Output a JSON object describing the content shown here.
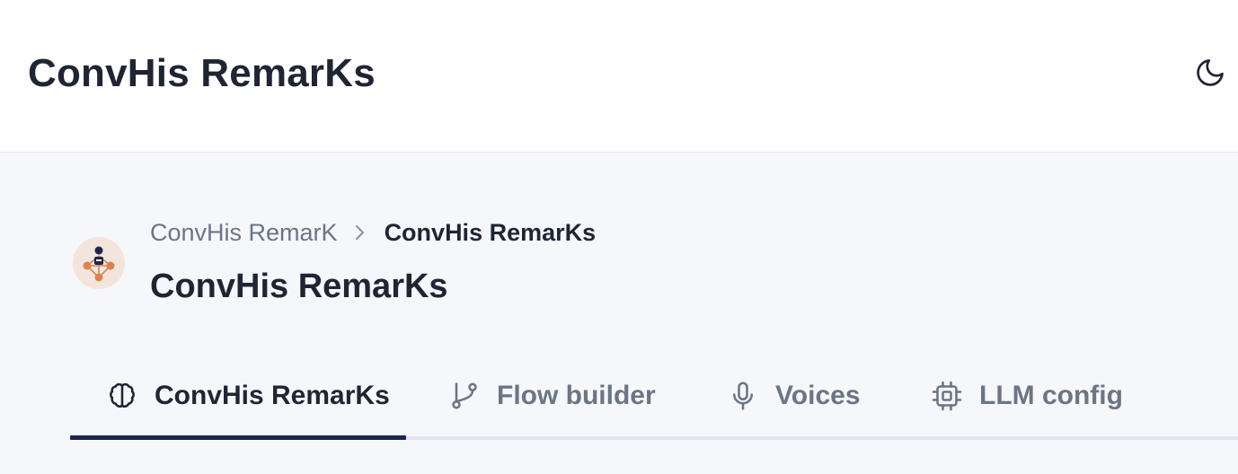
{
  "app": {
    "title": "ConvHis RemarKs"
  },
  "topbar": {
    "theme_toggle_icon": "moon-icon"
  },
  "breadcrumb": {
    "parent": "ConvHis RemarK",
    "separator_icon": "chevron-right-icon",
    "current": "ConvHis RemarKs"
  },
  "page": {
    "title": "ConvHis RemarKs",
    "avatar_icon": "agent-network-icon"
  },
  "tabs": [
    {
      "label": "ConvHis RemarKs",
      "icon": "brain-icon",
      "active": true
    },
    {
      "label": "Flow builder",
      "icon": "git-branch-icon",
      "active": false
    },
    {
      "label": "Voices",
      "icon": "microphone-icon",
      "active": false
    },
    {
      "label": "LLM config",
      "icon": "cpu-chip-icon",
      "active": false
    }
  ],
  "colors": {
    "background": "#f6f7fa",
    "text_primary": "#1f2533",
    "text_muted": "#6b7585",
    "tab_indicator": "#1b2550",
    "avatar_bg": "#f3e4de",
    "avatar_accent": "#d9844e"
  }
}
